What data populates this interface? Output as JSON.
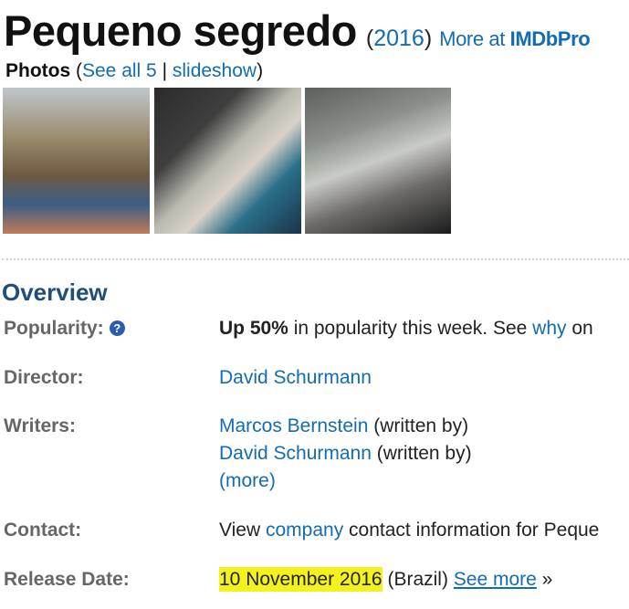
{
  "title": "Pequeno segredo",
  "year_open": "(",
  "year": "2016",
  "year_close": ")",
  "more_prefix": "More at ",
  "more_brand": "IMDbPro",
  "photos": {
    "label": "Photos",
    "open": " (",
    "see_all": "See all 5",
    "sep": " | ",
    "slideshow": "slideshow",
    "close": ")"
  },
  "overview": {
    "heading": "Overview",
    "popularity": {
      "label": "Popularity:",
      "help": "?",
      "bold": "Up 50%",
      "text": " in popularity this week. See ",
      "link": "why",
      "trail": " on"
    },
    "director": {
      "label": "Director:",
      "name": "David Schurmann"
    },
    "writers": {
      "label": "Writers:",
      "items": [
        {
          "name": "Marcos Bernstein",
          "role": " (written by)"
        },
        {
          "name": "David Schurmann",
          "role": " (written by)"
        }
      ],
      "more": "(more)"
    },
    "contact": {
      "label": "Contact:",
      "pre": "View ",
      "link": "company",
      "post": " contact information for Peque"
    },
    "release": {
      "label": "Release Date:",
      "date": "10 November 2016",
      "country": " (Brazil) ",
      "see_more": "See more",
      "arrow": " »"
    }
  }
}
